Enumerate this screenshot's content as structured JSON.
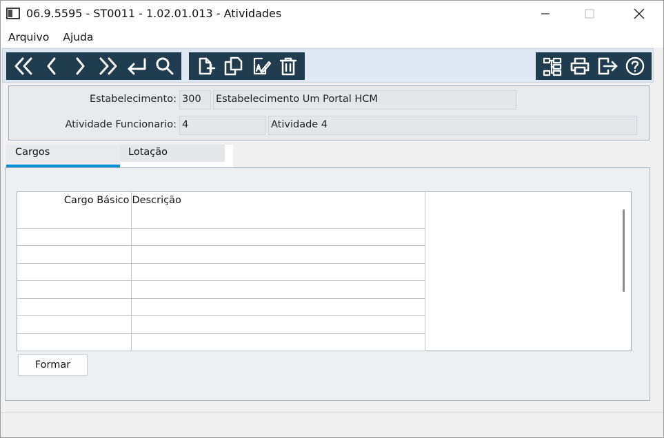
{
  "window": {
    "title": "06.9.5595 - ST0011 - 1.02.01.013 - Atividades",
    "controls": [
      "minimize-icon",
      "maximize-icon",
      "close-icon"
    ]
  },
  "menu": {
    "items": [
      {
        "label": "Arquivo"
      },
      {
        "label": "Ajuda"
      }
    ]
  },
  "toolbar": {
    "nav_group": [
      "first-record-icon",
      "previous-record-icon",
      "next-record-icon",
      "last-record-icon",
      "return-icon",
      "search-icon"
    ],
    "edit_group": [
      "new-record-icon",
      "copy-record-icon",
      "edit-record-icon",
      "delete-record-icon"
    ],
    "util_group": [
      "tree-structure-icon",
      "print-icon",
      "exit-icon",
      "help-icon"
    ],
    "colors": {
      "group_bg": "#1f3d4f",
      "bar_bg": "#dfe8f2",
      "icon": "#ffffff"
    }
  },
  "header": {
    "estabelecimento": {
      "label": "Estabelecimento:",
      "code": "300",
      "description": "Estabelecimento Um Portal HCM"
    },
    "atividade": {
      "label": "Atividade Funcionario:",
      "code": "4",
      "description": "Atividade 4"
    }
  },
  "tabs": [
    {
      "label": "Cargos",
      "active": true
    },
    {
      "label": "Lotação",
      "active": false
    }
  ],
  "grid": {
    "columns": [
      "Cargo Básico",
      "Descrição"
    ],
    "empty_rows": 7
  },
  "buttons": {
    "formar": "Formar"
  },
  "accent_color": "#0a8fd6"
}
